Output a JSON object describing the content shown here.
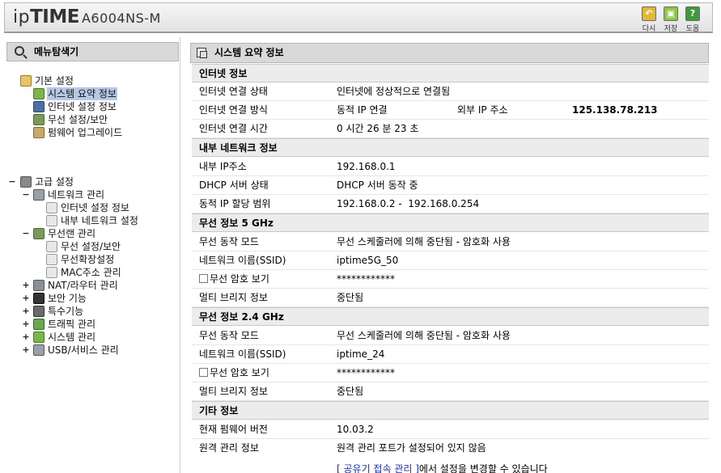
{
  "header": {
    "brand_light": "ip",
    "brand_bold": "TIME",
    "model": "A6004NS-M",
    "buttons": [
      {
        "label": "다시",
        "icon": "refresh-icon",
        "color": "#e0b93a"
      },
      {
        "label": "저장",
        "icon": "save-icon",
        "color": "#8cc63f"
      },
      {
        "label": "도움",
        "icon": "help-icon",
        "color": "#3f9a3f"
      }
    ]
  },
  "sidebar": {
    "title": "메뉴탐색기",
    "basic": {
      "label": "기본 설정",
      "items": [
        {
          "label": "시스템 요약 정보",
          "selected": true
        },
        {
          "label": "인터넷 설정 정보"
        },
        {
          "label": "무선 설정/보안"
        },
        {
          "label": "펌웨어 업그레이드"
        }
      ]
    },
    "advanced": {
      "label": "고급 설정",
      "groups": [
        {
          "label": "네트워크 관리",
          "toggle": "−",
          "children": [
            "인터넷 설정 정보",
            "내부 네트워크 설정"
          ]
        },
        {
          "label": "무선랜 관리",
          "toggle": "−",
          "children": [
            "무선 설정/보안",
            "무선확장설정",
            "MAC주소 관리"
          ]
        },
        {
          "label": "NAT/라우터 관리",
          "toggle": "+"
        },
        {
          "label": "보안 기능",
          "toggle": "+"
        },
        {
          "label": "특수기능",
          "toggle": "+"
        },
        {
          "label": "트래픽 관리",
          "toggle": "+"
        },
        {
          "label": "시스템 관리",
          "toggle": "+"
        },
        {
          "label": "USB/서비스 관리",
          "toggle": "+"
        }
      ],
      "toggle": "−"
    }
  },
  "main": {
    "title": "시스템 요약 정보",
    "internet": {
      "heading": "인터넷 정보",
      "status_label": "인터넷 연결 상태",
      "status_value": "인터넷에 정상적으로 연결됨",
      "method_label": "인터넷 연결 방식",
      "method_value": "동적 IP 연결",
      "external_ip_label": "외부 IP 주소",
      "external_ip_value": "125.138.78.213",
      "time_label": "인터넷 연결 시간",
      "time_value": "0 시간 26 분 23 초"
    },
    "lan": {
      "heading": "내부 네트워크 정보",
      "ip_label": "내부 IP주소",
      "ip_value": "192.168.0.1",
      "dhcp_label": "DHCP 서버 상태",
      "dhcp_value": "DHCP 서버 동작 중",
      "range_label": "동적 IP 할당 범위",
      "range_value": "192.168.0.2 -  192.168.0.254"
    },
    "wifi5": {
      "heading": "무선 정보 5 GHz",
      "mode_label": "무선 동작 모드",
      "mode_value": "무선 스케줄러에 의해 중단됨 - 암호화 사용",
      "ssid_label": "네트워크 이름(SSID)",
      "ssid_value": "iptime5G_50",
      "pw_label": "무선 암호 보기",
      "pw_value": "************",
      "bridge_label": "멀티 브리지 정보",
      "bridge_value": "중단됨"
    },
    "wifi24": {
      "heading": "무선 정보 2.4 GHz",
      "mode_label": "무선 동작 모드",
      "mode_value": "무선 스케줄러에 의해 중단됨 - 암호화 사용",
      "ssid_label": "네트워크 이름(SSID)",
      "ssid_value": "iptime_24",
      "pw_label": "무선 암호 보기",
      "pw_value": "************",
      "bridge_label": "멀티 브리지 정보",
      "bridge_value": "중단됨"
    },
    "etc": {
      "heading": "기타 정보",
      "fw_label": "현재 펌웨어 버전",
      "fw_value": "10.03.2",
      "remote_label": "원격 관리 정보",
      "remote_value": "원격 관리 포트가 설정되어 있지 않음",
      "note_link": "[ 공유기 접속 관리 ]",
      "note_text": "에서 설정을 변경할 수 있습니다"
    }
  }
}
